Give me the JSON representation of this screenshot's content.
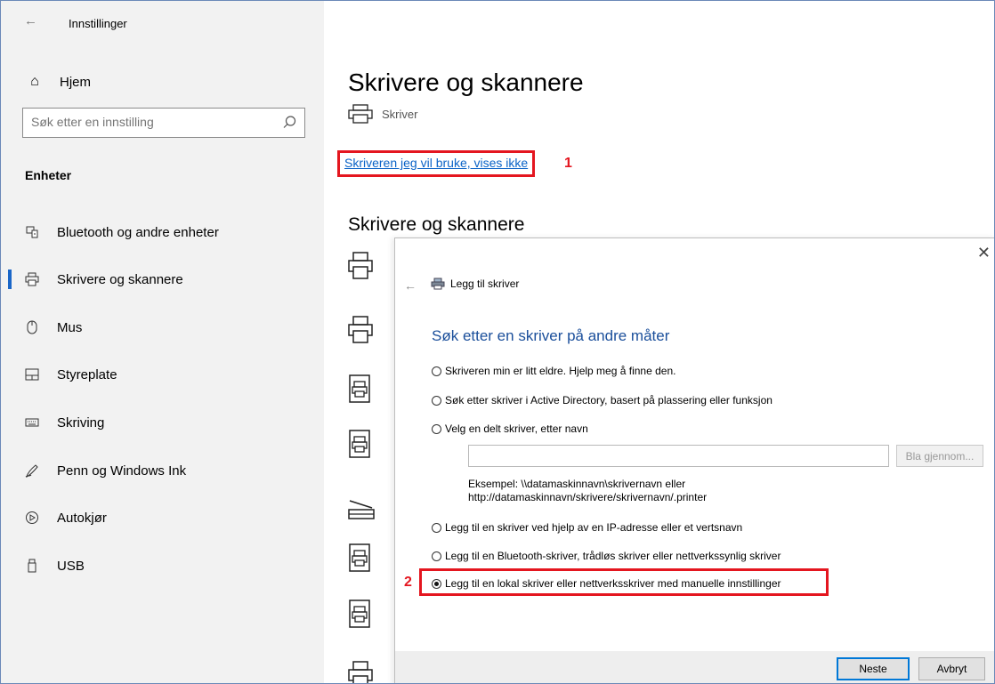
{
  "window": {
    "title": "Innstillinger"
  },
  "sidebar": {
    "home_label": "Hjem",
    "search_placeholder": "Søk etter en innstilling",
    "group_heading": "Enheter",
    "items": [
      {
        "label": "Bluetooth og andre enheter",
        "icon": "bluetooth-devices-icon",
        "active": false
      },
      {
        "label": "Skrivere og skannere",
        "icon": "printer-icon",
        "active": true
      },
      {
        "label": "Mus",
        "icon": "mouse-icon",
        "active": false
      },
      {
        "label": "Styreplate",
        "icon": "touchpad-icon",
        "active": false
      },
      {
        "label": "Skriving",
        "icon": "keyboard-icon",
        "active": false
      },
      {
        "label": "Penn og Windows Ink",
        "icon": "pen-icon",
        "active": false
      },
      {
        "label": "Autokjør",
        "icon": "autoplay-icon",
        "active": false
      },
      {
        "label": "USB",
        "icon": "usb-icon",
        "active": false
      }
    ]
  },
  "main": {
    "title": "Skrivere og skannere",
    "add_label": "Skriver",
    "missing_link": "Skriveren jeg vil bruke, vises ikke",
    "callout_1": "1",
    "list_heading": "Skrivere og skannere"
  },
  "dialog": {
    "header": "Legg til skriver",
    "heading": "Søk etter en skriver på andre måter",
    "options": [
      {
        "label": "Skriveren min er litt eldre. Hjelp meg å finne den.",
        "selected": false
      },
      {
        "label": "Søk etter skriver i Active Directory, basert på plassering eller funksjon",
        "selected": false
      },
      {
        "label": "Velg en delt skriver, etter navn",
        "selected": false
      },
      {
        "label": "Legg til en skriver ved hjelp av en IP-adresse eller et vertsnavn",
        "selected": false
      },
      {
        "label": "Legg til en Bluetooth-skriver, trådløs skriver eller nettverkssynlig skriver",
        "selected": false
      },
      {
        "label": "Legg til en lokal skriver eller nettverksskriver med manuelle innstillinger",
        "selected": true
      }
    ],
    "shared_value": "",
    "browse_label": "Bla gjennom...",
    "example_line1": "Eksempel: \\\\datamaskinnavn\\skrivernavn eller",
    "example_line2": "http://datamaskinnavn/skrivere/skrivernavn/.printer",
    "callout_2": "2",
    "next_label": "Neste",
    "cancel_label": "Avbryt"
  },
  "colors": {
    "accent": "#0078d7",
    "link": "#0a63c7",
    "heading_blue": "#1b4f9b",
    "callout_red": "#e4161f",
    "sidebar_bg": "#f2f2f2"
  }
}
